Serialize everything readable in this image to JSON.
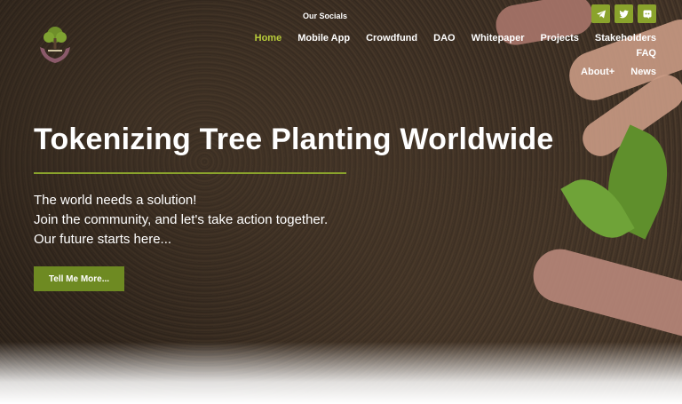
{
  "header": {
    "socials_label": "Our Socials",
    "social_icons": [
      "telegram-icon",
      "twitter-icon",
      "discord-icon"
    ]
  },
  "nav": {
    "items": [
      {
        "label": "Home",
        "active": true
      },
      {
        "label": "Mobile App"
      },
      {
        "label": "Crowdfund"
      },
      {
        "label": "DAO"
      },
      {
        "label": "Whitepaper"
      },
      {
        "label": "Projects"
      },
      {
        "label": "Stakeholders"
      },
      {
        "label": "FAQ"
      },
      {
        "label": "About+"
      },
      {
        "label": "News"
      }
    ]
  },
  "hero": {
    "headline": "Tokenizing Tree Planting Worldwide",
    "lines": [
      "The world needs a solution!",
      "Join the community, and let's take action together.",
      "Our future starts here..."
    ],
    "cta_label": "Tell Me More..."
  },
  "colors": {
    "accent": "#8aa32c",
    "active_nav": "#b8cc3a",
    "button": "#6e8a22"
  }
}
